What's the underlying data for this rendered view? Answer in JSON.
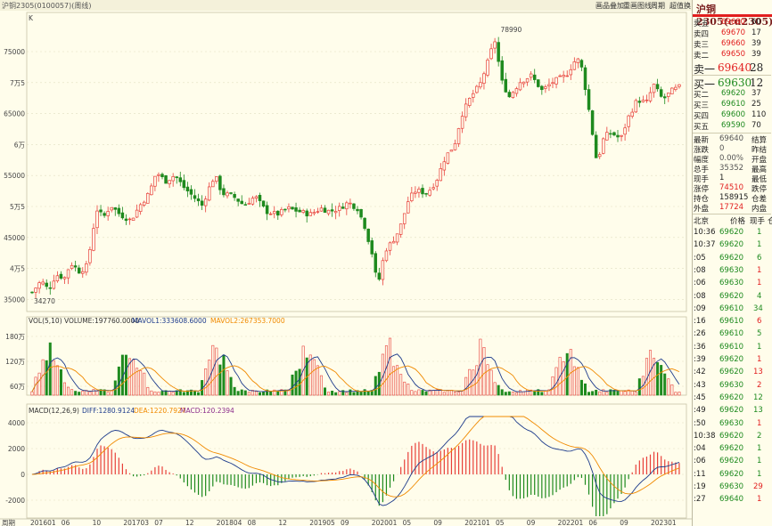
{
  "toolbar": {
    "title": "沪铜2305(0100057)(周线)",
    "items": [
      "画品叠加",
      "重画图线",
      "周期",
      "超值换生"
    ]
  },
  "main_chart": {
    "corner": "K",
    "y_labels": [
      "75000",
      "7万5",
      "65000",
      "6万",
      "55000",
      "5万5",
      "45000",
      "4万5",
      "35000"
    ],
    "high_label": "78990",
    "low_label": "34270"
  },
  "vol_panel": {
    "header": "VOL(5,10) VOLUME:197760.0000",
    "mavol1": "MAVOL1:333608.6000",
    "mavol2": "MAVOL2:267353.7000",
    "y_labels": [
      "180万",
      "120万",
      "60万"
    ]
  },
  "macd_panel": {
    "header": "MACD(12,26,9)",
    "diff": "DIFF:1280.9124",
    "dea": "DEA:1220.7927",
    "macd": "MACD:120.2394",
    "y_labels": [
      "4000",
      "2000",
      "0",
      "-2000"
    ]
  },
  "x_axis": [
    "周期",
    "201601",
    "06",
    "10",
    "201703",
    "07",
    "12",
    "201804",
    "08",
    "12",
    "201905",
    "09",
    "202001",
    "05",
    "09",
    "202101",
    "05",
    "09",
    "202201",
    "06",
    "09",
    "202301"
  ],
  "quote": {
    "title": "沪铜2305(cu2305)",
    "asks": [
      {
        "label": "卖五",
        "price": "69680",
        "vol": "60"
      },
      {
        "label": "卖四",
        "price": "69670",
        "vol": "17"
      },
      {
        "label": "卖三",
        "price": "69660",
        "vol": "39"
      },
      {
        "label": "卖二",
        "price": "69650",
        "vol": "39"
      },
      {
        "label": "卖一",
        "price": "69640",
        "vol": "28"
      }
    ],
    "bids": [
      {
        "label": "买一",
        "price": "69630",
        "vol": "12"
      },
      {
        "label": "买二",
        "price": "69620",
        "vol": "37"
      },
      {
        "label": "买三",
        "price": "69610",
        "vol": "25"
      },
      {
        "label": "买四",
        "price": "69600",
        "vol": "110"
      },
      {
        "label": "买五",
        "price": "69590",
        "vol": "70"
      }
    ],
    "stats": [
      {
        "label": "最新",
        "value": "69640",
        "right": "结算",
        "color": "gry"
      },
      {
        "label": "涨跌",
        "value": "0",
        "right": "昨结",
        "color": "gry"
      },
      {
        "label": "幅度",
        "value": "0.00%",
        "right": "开盘",
        "color": "gry"
      },
      {
        "label": "总手",
        "value": "35352",
        "right": "最高",
        "color": "gry"
      },
      {
        "label": "现手",
        "value": "1",
        "right": "最低",
        "color": "blk"
      },
      {
        "label": "涨停",
        "value": "74510",
        "right": "跌停",
        "color": "red"
      },
      {
        "label": "持仓",
        "value": "158915",
        "right": "仓差",
        "color": "blk"
      },
      {
        "label": "外盘",
        "value": "17724",
        "right": "内盘",
        "color": "red"
      }
    ],
    "ticks_header": {
      "c1": "北京",
      "c2": "价格",
      "c3": "现手",
      "c4": "仓"
    },
    "ticks": [
      {
        "t": "10:36",
        "p": "69620",
        "v": "1",
        "c": "grn"
      },
      {
        "t": "10:37",
        "p": "69620",
        "v": "1",
        "c": "grn"
      },
      {
        "t": ":05",
        "p": "69620",
        "v": "6",
        "c": "grn"
      },
      {
        "t": ":08",
        "p": "69630",
        "v": "1",
        "c": "red"
      },
      {
        "t": ":06",
        "p": "69630",
        "v": "1",
        "c": "red"
      },
      {
        "t": ":08",
        "p": "69620",
        "v": "4",
        "c": "grn"
      },
      {
        "t": ":09",
        "p": "69610",
        "v": "34",
        "c": "grn"
      },
      {
        "t": ":16",
        "p": "69610",
        "v": "6",
        "c": "red"
      },
      {
        "t": ":26",
        "p": "69610",
        "v": "5",
        "c": "grn"
      },
      {
        "t": ":36",
        "p": "69610",
        "v": "1",
        "c": "grn"
      },
      {
        "t": ":39",
        "p": "69620",
        "v": "1",
        "c": "red"
      },
      {
        "t": ":42",
        "p": "69620",
        "v": "13",
        "c": "red"
      },
      {
        "t": ":43",
        "p": "69630",
        "v": "2",
        "c": "red"
      },
      {
        "t": ":45",
        "p": "69620",
        "v": "12",
        "c": "grn"
      },
      {
        "t": ":49",
        "p": "69620",
        "v": "13",
        "c": "grn"
      },
      {
        "t": ":50",
        "p": "69630",
        "v": "1",
        "c": "red"
      },
      {
        "t": "10:38",
        "p": "69620",
        "v": "2",
        "c": "grn"
      },
      {
        "t": ":04",
        "p": "69620",
        "v": "1",
        "c": "grn"
      },
      {
        "t": ":06",
        "p": "69620",
        "v": "1",
        "c": "grn"
      },
      {
        "t": ":11",
        "p": "69620",
        "v": "1",
        "c": "grn"
      },
      {
        "t": ":19",
        "p": "69630",
        "v": "29",
        "c": "red"
      },
      {
        "t": ":27",
        "p": "69640",
        "v": "1",
        "c": "red"
      }
    ]
  },
  "colors": {
    "up": "#E8403A",
    "down": "#1E8A1E",
    "ma1": "#1E3C8C",
    "ma2": "#F08A00",
    "bg": "#FFFDEB"
  }
}
